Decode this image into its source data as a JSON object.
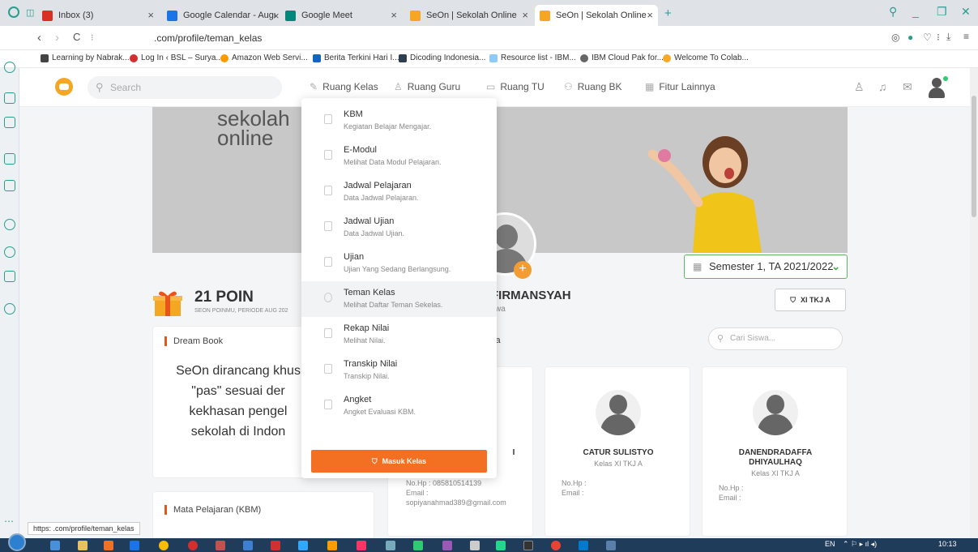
{
  "browser": {
    "tabs": [
      {
        "label": "Inbox (3)",
        "icon": "gmail-icon",
        "color": "#d93025"
      },
      {
        "label": "Google Calendar - August",
        "icon": "calendar-icon",
        "color": "#1a73e8"
      },
      {
        "label": "Google Meet",
        "icon": "meet-icon",
        "color": "#00897b"
      },
      {
        "label": "SeOn | Sekolah Online",
        "icon": "seon-icon",
        "color": "#f5a623"
      },
      {
        "label": "SeOn | Sekolah Online",
        "icon": "seon-icon",
        "color": "#f5a623"
      }
    ],
    "url": ".com/profile/teman_kelas",
    "bookmarks": [
      {
        "label": "Learning by Nabrak...",
        "color": "#444"
      },
      {
        "label": "Log In ‹ BSL – Surya...",
        "color": "#d32f2f"
      },
      {
        "label": "Amazon Web Servi...",
        "color": "#f90"
      },
      {
        "label": "Berita Terkini Hari I...",
        "color": "#1565c0"
      },
      {
        "label": "Dicoding Indonesia...",
        "color": "#2c3e50"
      },
      {
        "label": "Resource list - IBM...",
        "color": "#90caf9"
      },
      {
        "label": "IBM Cloud Pak for...",
        "color": "#666"
      },
      {
        "label": "Welcome To Colab...",
        "color": "#f9a825"
      }
    ],
    "status_url": "https:  .com/profile/teman_kelas"
  },
  "nav": {
    "search_placeholder": "Search",
    "menus": [
      "Ruang Kelas",
      "Ruang Guru",
      "Ruang TU",
      "Ruang BK",
      "Fitur Lainnya"
    ]
  },
  "banner": {
    "text_line1": "sekolah",
    "text_line2": "online"
  },
  "semester": "Semester 1, TA 2021/2022",
  "poin": {
    "value": "21 POIN",
    "sub": "SEON POINMU, PERIODE AUG 202"
  },
  "profile": {
    "name_fragment": "FIRMANSYAH",
    "role_fragment": "swa",
    "class_button": "XI TKJ A"
  },
  "dreambook": {
    "title": "Dream Book",
    "body": "SeOn dirancang khus \"pas\" sesuai der kekhasan pengel sekolah di Indon"
  },
  "mapel": {
    "title": "Mata Pelajaran  (KBM)"
  },
  "classmates": {
    "title_fragment": "va",
    "search_placeholder": "Cari Siswa...",
    "students": [
      {
        "name": "I",
        "kelas": "",
        "hp": "No.Hp : 085810514139",
        "email_label": "Email :",
        "email": "sopiyanahmad389@gmail.com"
      },
      {
        "name": "CATUR SULISTYO",
        "kelas": "Kelas XI TKJ A",
        "hp": "No.Hp :",
        "email_label": "Email :",
        "email": ""
      },
      {
        "name": "DANENDRADAFFA DHIYAULHAQ",
        "kelas": "Kelas XI TKJ A",
        "hp": "No.Hp :",
        "email_label": "Email :",
        "email": ""
      }
    ]
  },
  "dropdown": {
    "items": [
      {
        "title": "KBM",
        "sub": "Kegiatan Belajar Mengajar."
      },
      {
        "title": "E-Modul",
        "sub": "Melihat Data Modul Pelajaran."
      },
      {
        "title": "Jadwal Pelajaran",
        "sub": "Data Jadwal Pelajaran."
      },
      {
        "title": "Jadwal Ujian",
        "sub": "Data Jadwal Ujian."
      },
      {
        "title": "Ujian",
        "sub": "Ujian Yang Sedang Berlangsung."
      },
      {
        "title": "Teman Kelas",
        "sub": "Melihat Daftar Teman Sekelas."
      },
      {
        "title": "Rekap Nilai",
        "sub": "Melihat Nilai."
      },
      {
        "title": "Transkip Nilai",
        "sub": "Transkip Nilai."
      },
      {
        "title": "Angket",
        "sub": "Angket Evaluasi KBM."
      }
    ],
    "button": "Masuk Kelas"
  },
  "taskbar": {
    "lang": "EN",
    "time": "10:13"
  },
  "colors": {
    "accent": "#f36f21",
    "green": "#4caf50",
    "teal": "#2a9d8f"
  }
}
